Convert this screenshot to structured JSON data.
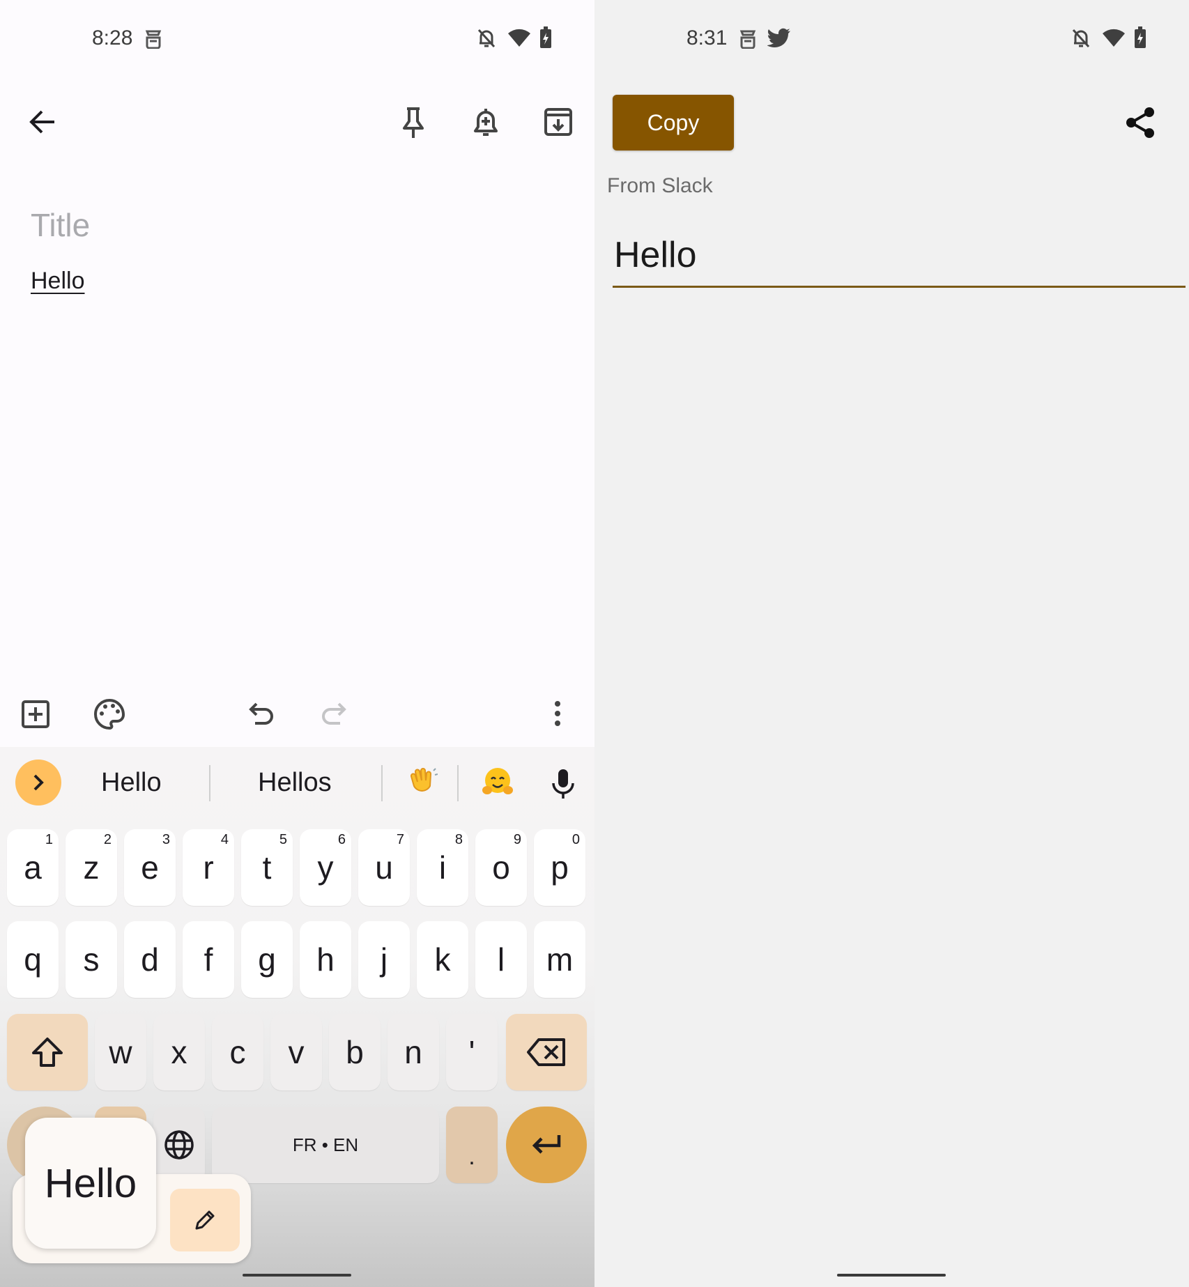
{
  "left": {
    "status_time": "8:28",
    "note": {
      "title_placeholder": "Title",
      "body_text": "Hello"
    },
    "keyboard": {
      "suggestions": [
        "Hello",
        "Hellos"
      ],
      "row1": [
        {
          "key": "a",
          "hint": "1"
        },
        {
          "key": "z",
          "hint": "2"
        },
        {
          "key": "e",
          "hint": "3"
        },
        {
          "key": "r",
          "hint": "4"
        },
        {
          "key": "t",
          "hint": "5"
        },
        {
          "key": "y",
          "hint": "6"
        },
        {
          "key": "u",
          "hint": "7"
        },
        {
          "key": "i",
          "hint": "8"
        },
        {
          "key": "o",
          "hint": "9"
        },
        {
          "key": "p",
          "hint": "0"
        }
      ],
      "row2": [
        "q",
        "s",
        "d",
        "f",
        "g",
        "h",
        "j",
        "k",
        "l",
        "m"
      ],
      "row3": [
        "w",
        "x",
        "c",
        "v",
        "b",
        "n",
        "'"
      ],
      "space_label": "FR • EN",
      "period_key": "."
    },
    "clipboard_popup": {
      "text": "Hello"
    },
    "icons": {
      "status": [
        "keep-notification-icon",
        "dnd-off-icon",
        "wifi-icon",
        "battery-charging-icon"
      ],
      "toolbar": [
        "back-arrow-icon",
        "pin-icon",
        "reminder-icon",
        "archive-icon"
      ],
      "editor_bar": [
        "add-box-icon",
        "palette-icon",
        "undo-icon",
        "redo-icon",
        "more-vert-icon"
      ],
      "keyboard": [
        "expand-icon",
        "waving-hand-emoji",
        "hugging-face-emoji",
        "mic-icon",
        "shift-icon",
        "backspace-icon",
        "globe-icon",
        "enter-icon",
        "pencil-icon"
      ]
    }
  },
  "right": {
    "status_time": "8:31",
    "copy_label": "Copy",
    "from_label": "From Slack",
    "input_value": "Hello",
    "icons": [
      "keep-notification-icon",
      "twitter-icon",
      "dnd-off-icon",
      "wifi-icon",
      "battery-charging-icon",
      "share-icon"
    ]
  },
  "colors": {
    "accent_brown": "#865500",
    "underline": "#7b5a17",
    "expand_button": "#ffbf5e",
    "enter_key": "#e0a649",
    "special_key": "#f2d9bd"
  }
}
